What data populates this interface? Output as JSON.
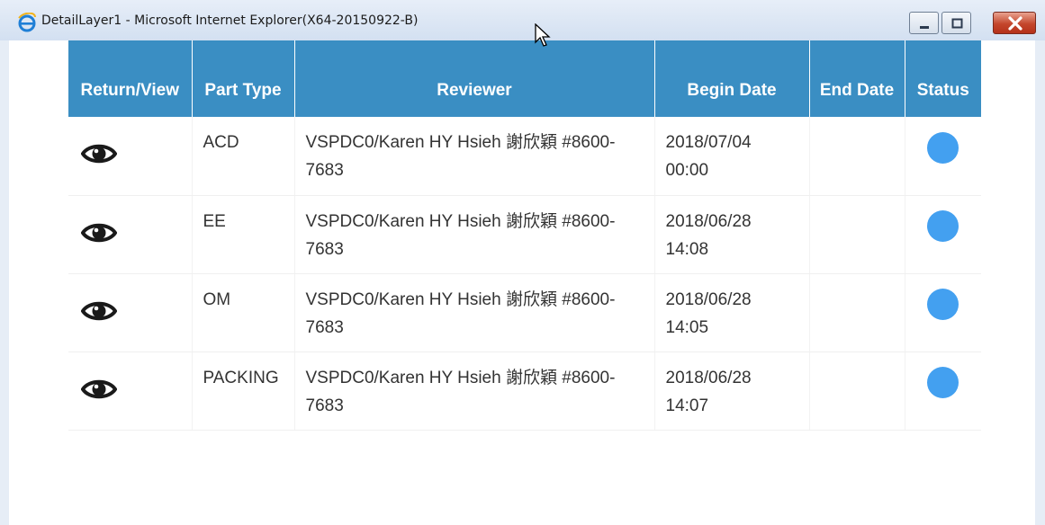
{
  "window": {
    "title": "DetailLayer1 - Microsoft Internet Explorer(X64-20150922-B)",
    "icon": "internet-explorer-icon",
    "buttons": [
      "minimize",
      "maximize",
      "close"
    ]
  },
  "table": {
    "headers": {
      "return_view": "Return/View",
      "part_type": "Part Type",
      "reviewer": "Reviewer",
      "begin_date": "Begin Date",
      "end_date": "End Date",
      "status": "Status"
    },
    "rows": [
      {
        "view_icon": "eye-icon",
        "part_type": "ACD",
        "reviewer": "VSPDC0/Karen HY Hsieh 謝欣穎 #8600-7683",
        "begin_date": "2018/07/04 00:00",
        "end_date": "",
        "status_color": "#43a0f0"
      },
      {
        "view_icon": "eye-icon",
        "part_type": "EE",
        "reviewer": "VSPDC0/Karen HY Hsieh 謝欣穎 #8600-7683",
        "begin_date": "2018/06/28 14:08",
        "end_date": "",
        "status_color": "#43a0f0"
      },
      {
        "view_icon": "eye-icon",
        "part_type": "OM",
        "reviewer": "VSPDC0/Karen HY Hsieh 謝欣穎 #8600-7683",
        "begin_date": "2018/06/28 14:05",
        "end_date": "",
        "status_color": "#43a0f0"
      },
      {
        "view_icon": "eye-icon",
        "part_type": "PACKING",
        "reviewer": "VSPDC0/Karen HY Hsieh 謝欣穎 #8600-7683",
        "begin_date": "2018/06/28 14:07",
        "end_date": "",
        "status_color": "#43a0f0"
      }
    ]
  },
  "colors": {
    "header_bg": "#3a8ec3",
    "header_text": "#ffffff",
    "status_dot": "#43a0f0"
  }
}
